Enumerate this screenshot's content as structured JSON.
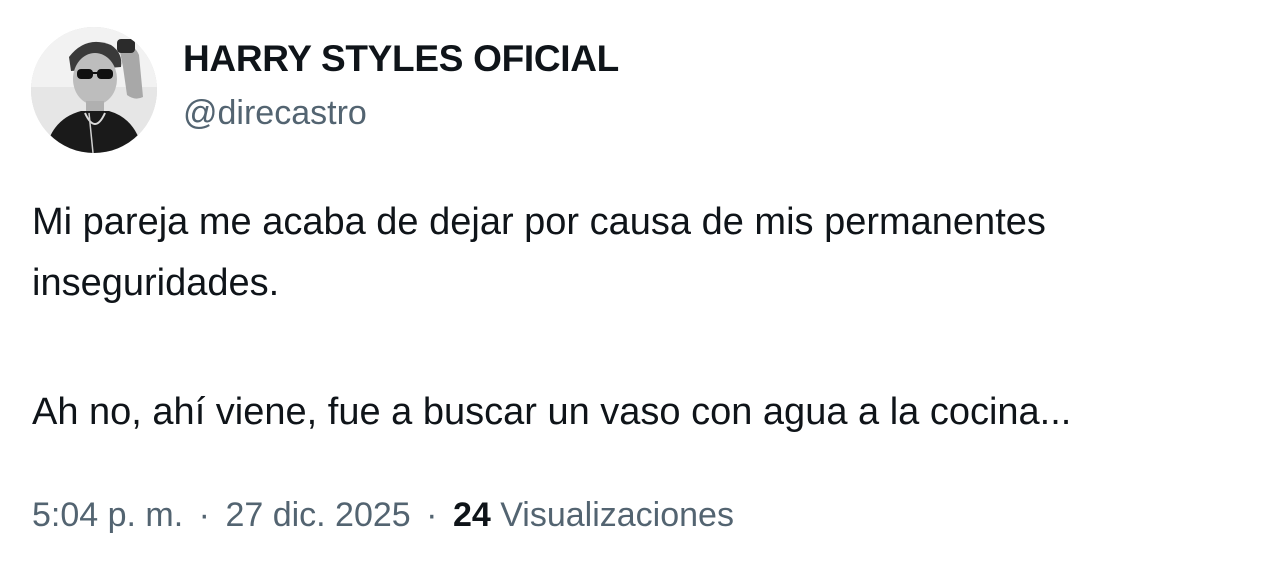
{
  "tweet": {
    "author": {
      "display_name": "HARRY STYLES OFICIAL",
      "handle": "@direcastro",
      "avatar_icon": "profile-photo"
    },
    "text_lines": [
      "Mi pareja me acaba de dejar por causa de mis permanentes",
      "inseguridades.",
      "Ah no, ahí viene, fue a buscar un vaso con agua a la cocina..."
    ],
    "time": "5:04 p. m.",
    "separator": "·",
    "date": "27 dic. 2025",
    "views_count": "24",
    "views_label": "Visualizaciones",
    "colors": {
      "text": "#0f1419",
      "secondary": "#536471",
      "background": "#ffffff"
    }
  }
}
